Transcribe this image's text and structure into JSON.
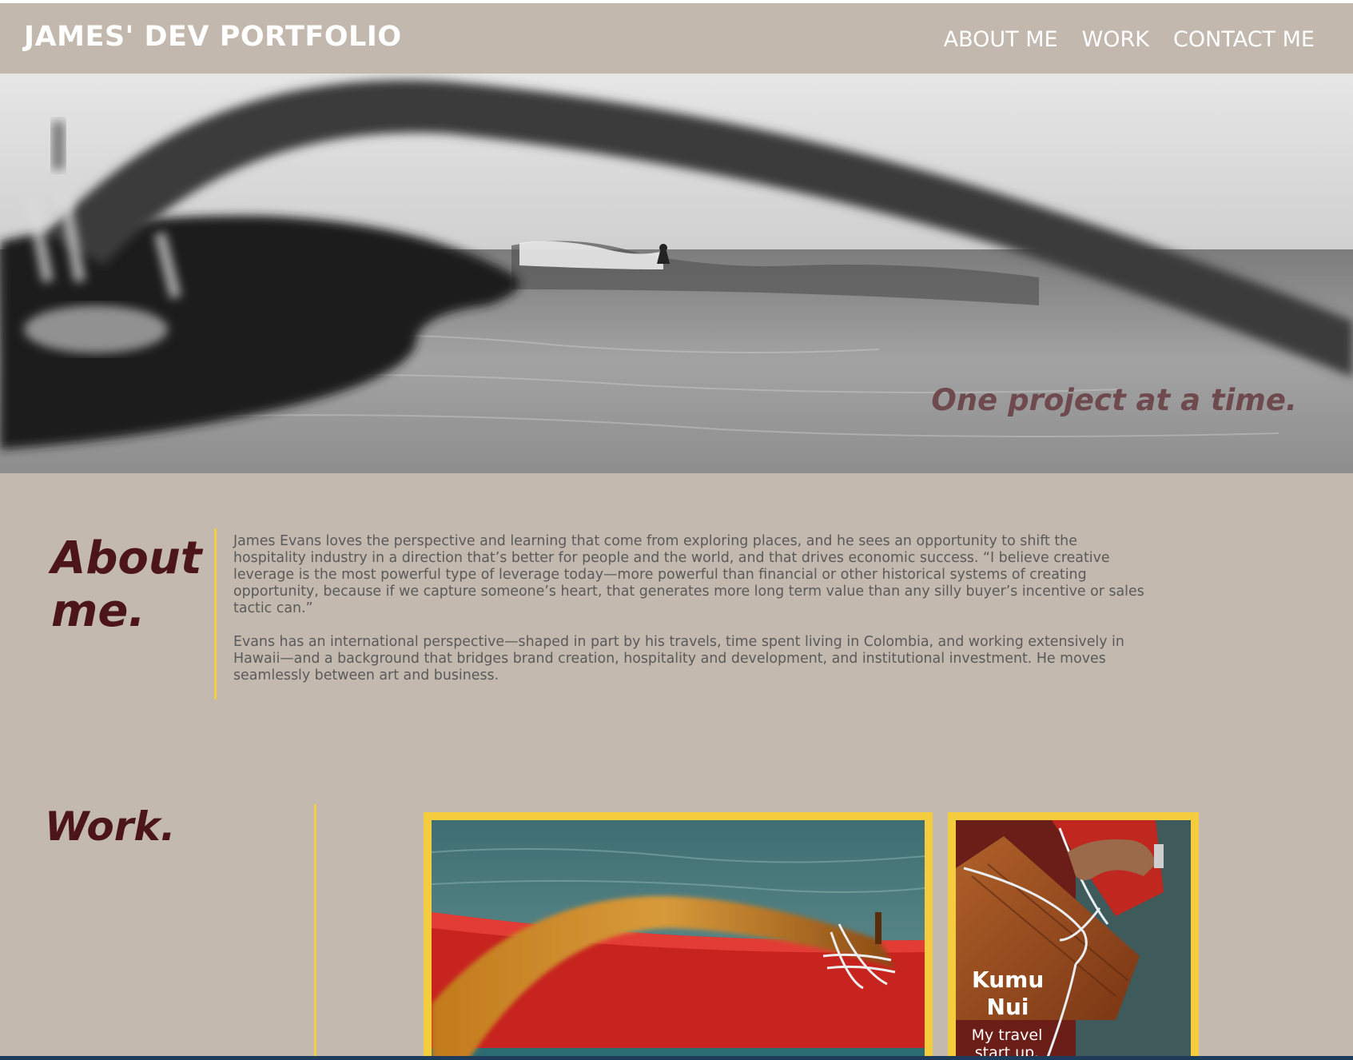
{
  "header": {
    "brand": "JAMES' DEV PORTFOLIO",
    "nav": [
      "ABOUT ME",
      "WORK",
      "CONTACT ME"
    ]
  },
  "hero": {
    "tagline": "One project at a time."
  },
  "about": {
    "title_line1": "About",
    "title_line2": "me.",
    "paragraphs": [
      "James Evans loves the perspective and learning that come from exploring places, and he sees an opportunity to shift the hospitality industry in a direction that’s better for people and the world, and that drives economic success. “I believe creative leverage is the most powerful type of leverage today—more powerful than financial or other historical systems of creating opportunity, because if we capture someone’s heart, that generates more long term value than any silly buyer’s incentive or sales tactic can.”",
      "Evans has an international perspective—shaped in part by his travels, time spent living in Colombia, and working extensively in Hawaii—and a background that bridges brand creation, hospitality and development, and institutional investment. He moves seamlessly between art and business."
    ]
  },
  "work": {
    "title": "Work.",
    "projects": [
      {
        "title": "",
        "subtitle": ""
      },
      {
        "title": "Kumu Nui",
        "subtitle": "My travel start up."
      }
    ]
  },
  "colors": {
    "background": "#c3b9ae",
    "accent": "#f3cd3e",
    "heading": "#4b1519",
    "tagline": "#6e4a4f"
  }
}
